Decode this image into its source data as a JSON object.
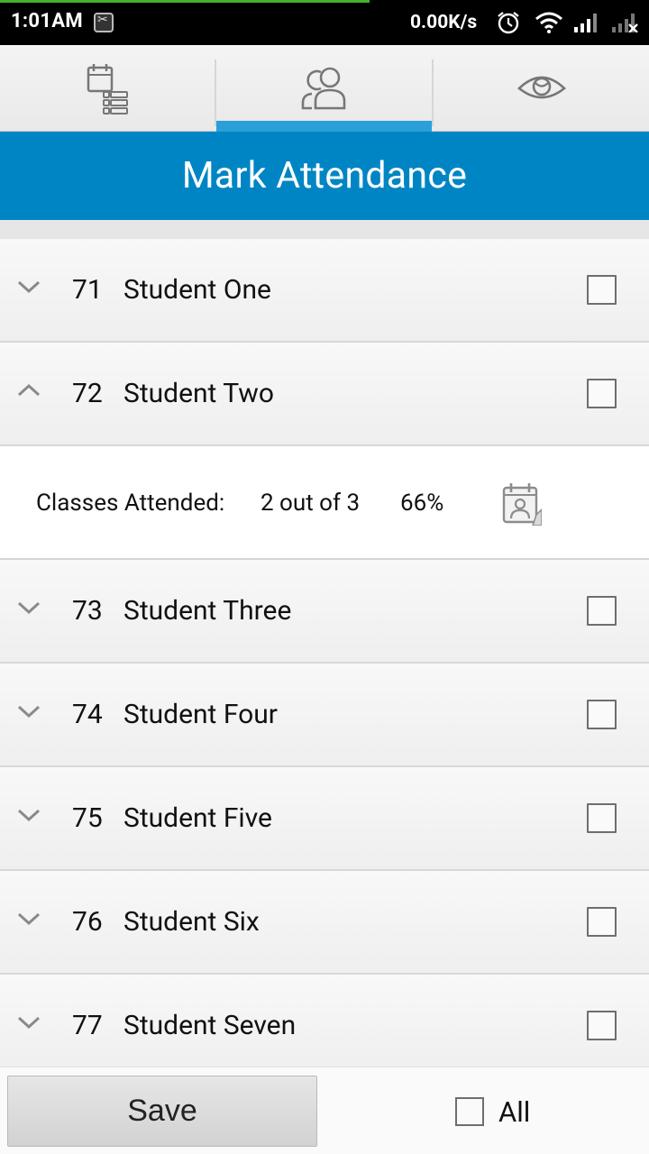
{
  "status_bar": {
    "time": "1:01AM",
    "net_speed": "0.00K/s",
    "icons": [
      "notification-icon",
      "alarm-icon",
      "wifi-icon",
      "signal-icon",
      "signal-off-icon"
    ]
  },
  "tabs": [
    {
      "name": "schedule-list",
      "icon": "calendar-list-icon",
      "selected": false
    },
    {
      "name": "students",
      "icon": "people-icon",
      "selected": true
    },
    {
      "name": "view",
      "icon": "eye-icon",
      "selected": false
    }
  ],
  "header": {
    "title": "Mark Attendance"
  },
  "students": [
    {
      "roll": "71",
      "name": "Student One",
      "expanded": false,
      "checked": false
    },
    {
      "roll": "72",
      "name": "Student Two",
      "expanded": true,
      "checked": false
    },
    {
      "roll": "73",
      "name": "Student Three",
      "expanded": false,
      "checked": false
    },
    {
      "roll": "74",
      "name": "Student Four",
      "expanded": false,
      "checked": false
    },
    {
      "roll": "75",
      "name": "Student Five",
      "expanded": false,
      "checked": false
    },
    {
      "roll": "76",
      "name": "Student Six",
      "expanded": false,
      "checked": false
    },
    {
      "roll": "77",
      "name": "Student Seven",
      "expanded": false,
      "checked": false
    }
  ],
  "detail": {
    "label": "Classes Attended:",
    "count": "2 out of 3",
    "percent": "66%"
  },
  "footer": {
    "save_label": "Save",
    "all_label": "All",
    "all_checked": false
  },
  "colors": {
    "header_bg": "#0085c4",
    "tab_indicator": "#2a9fd8",
    "status_bar_bg": "#000000"
  }
}
